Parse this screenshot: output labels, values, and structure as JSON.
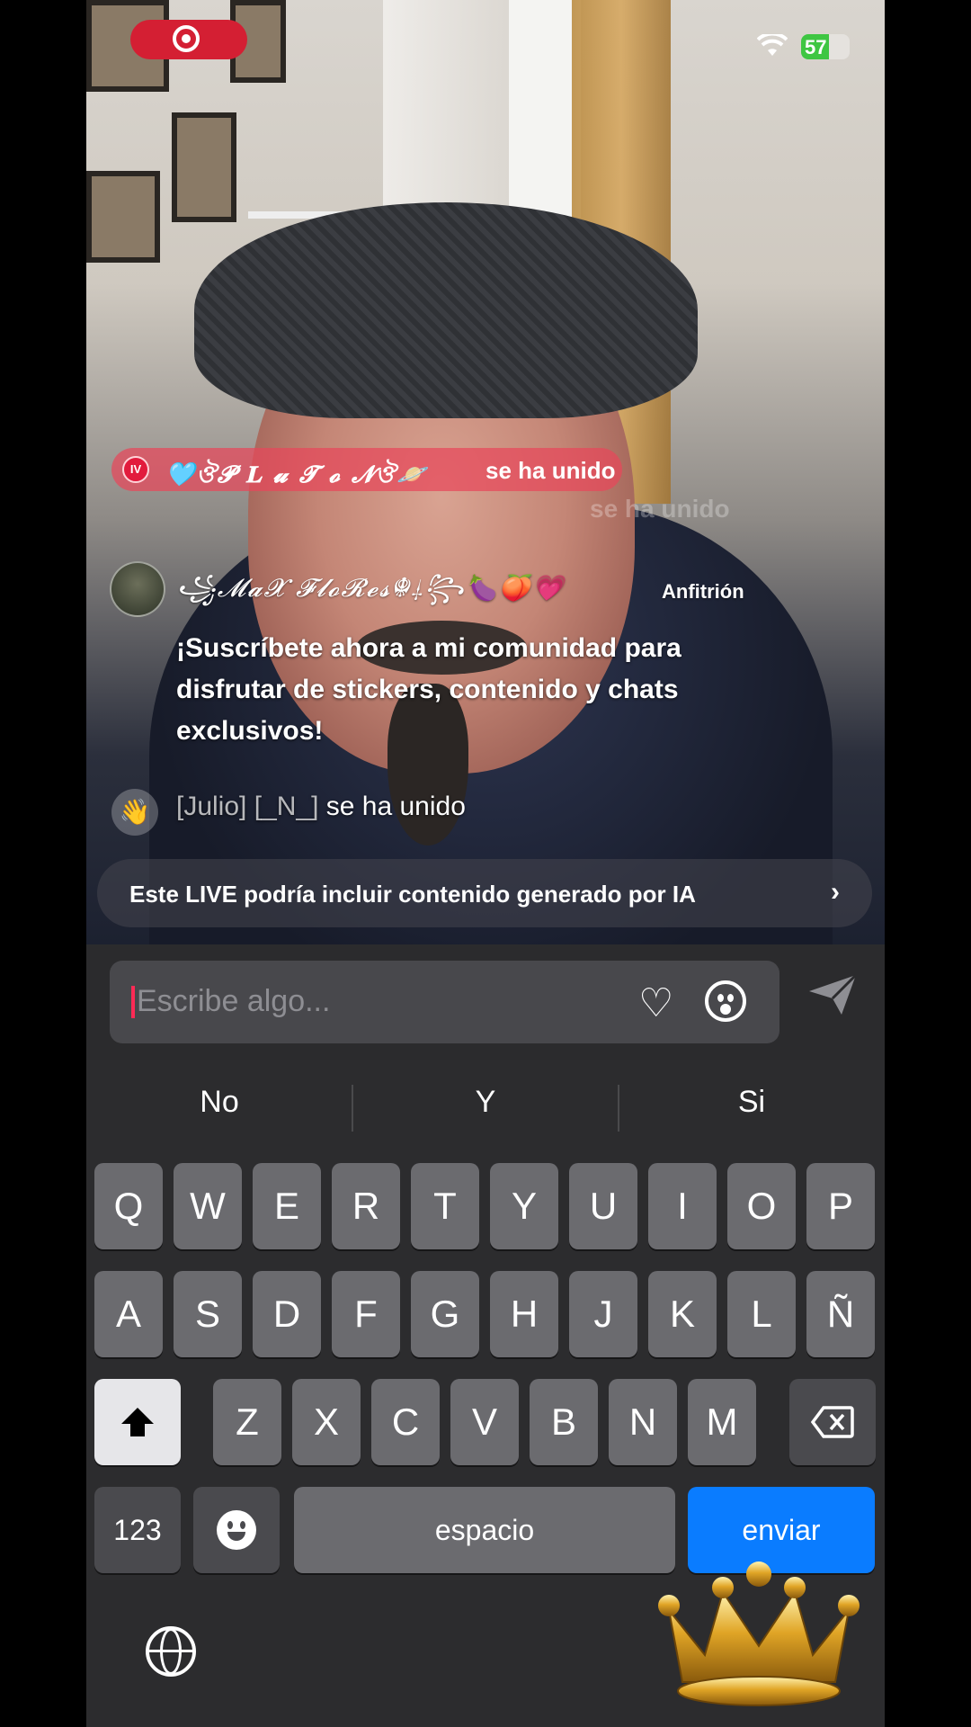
{
  "status_bar": {
    "battery": "57",
    "battery_level": 0.57,
    "recording": true
  },
  "join_banner": {
    "badge": "IV",
    "name": "🩵ঔ𝓟 𝐋 𝓾 𝓣 𝓸 𝓝ঔ🪐",
    "suffix": "se ha unido"
  },
  "ghost_comment": "se ha unido",
  "host_comment": {
    "name": "꧁𝓜𝓪𝓧 𝓕𝓵𝓸𝓡𝓮𝓼☬⸸꧂🍆🍑💗",
    "badge": "Anfitrión",
    "message": "¡Suscríbete ahora a mi comunidad para disfrutar de stickers, contenido y chats exclusivos!"
  },
  "joined_comment": {
    "user": "[Julio] [_N_]",
    "suffix": "se ha unido"
  },
  "ai_notice": {
    "text": "Este LIVE podría incluir contenido generado por IA",
    "icon": "chevron-right-icon"
  },
  "input": {
    "placeholder": "Escribe algo..."
  },
  "keyboard": {
    "suggestions": [
      "No",
      "Y",
      "Si"
    ],
    "row1": [
      "Q",
      "W",
      "E",
      "R",
      "T",
      "Y",
      "U",
      "I",
      "O",
      "P"
    ],
    "row2": [
      "A",
      "S",
      "D",
      "F",
      "G",
      "H",
      "J",
      "K",
      "L",
      "Ñ"
    ],
    "row3": [
      "Z",
      "X",
      "C",
      "V",
      "B",
      "N",
      "M"
    ],
    "numbers_label": "123",
    "space_label": "espacio",
    "send_label": "enviar"
  },
  "colors": {
    "accent": "#0a7cff",
    "join_banner": "#e8465a",
    "rec": "#d41f33"
  }
}
